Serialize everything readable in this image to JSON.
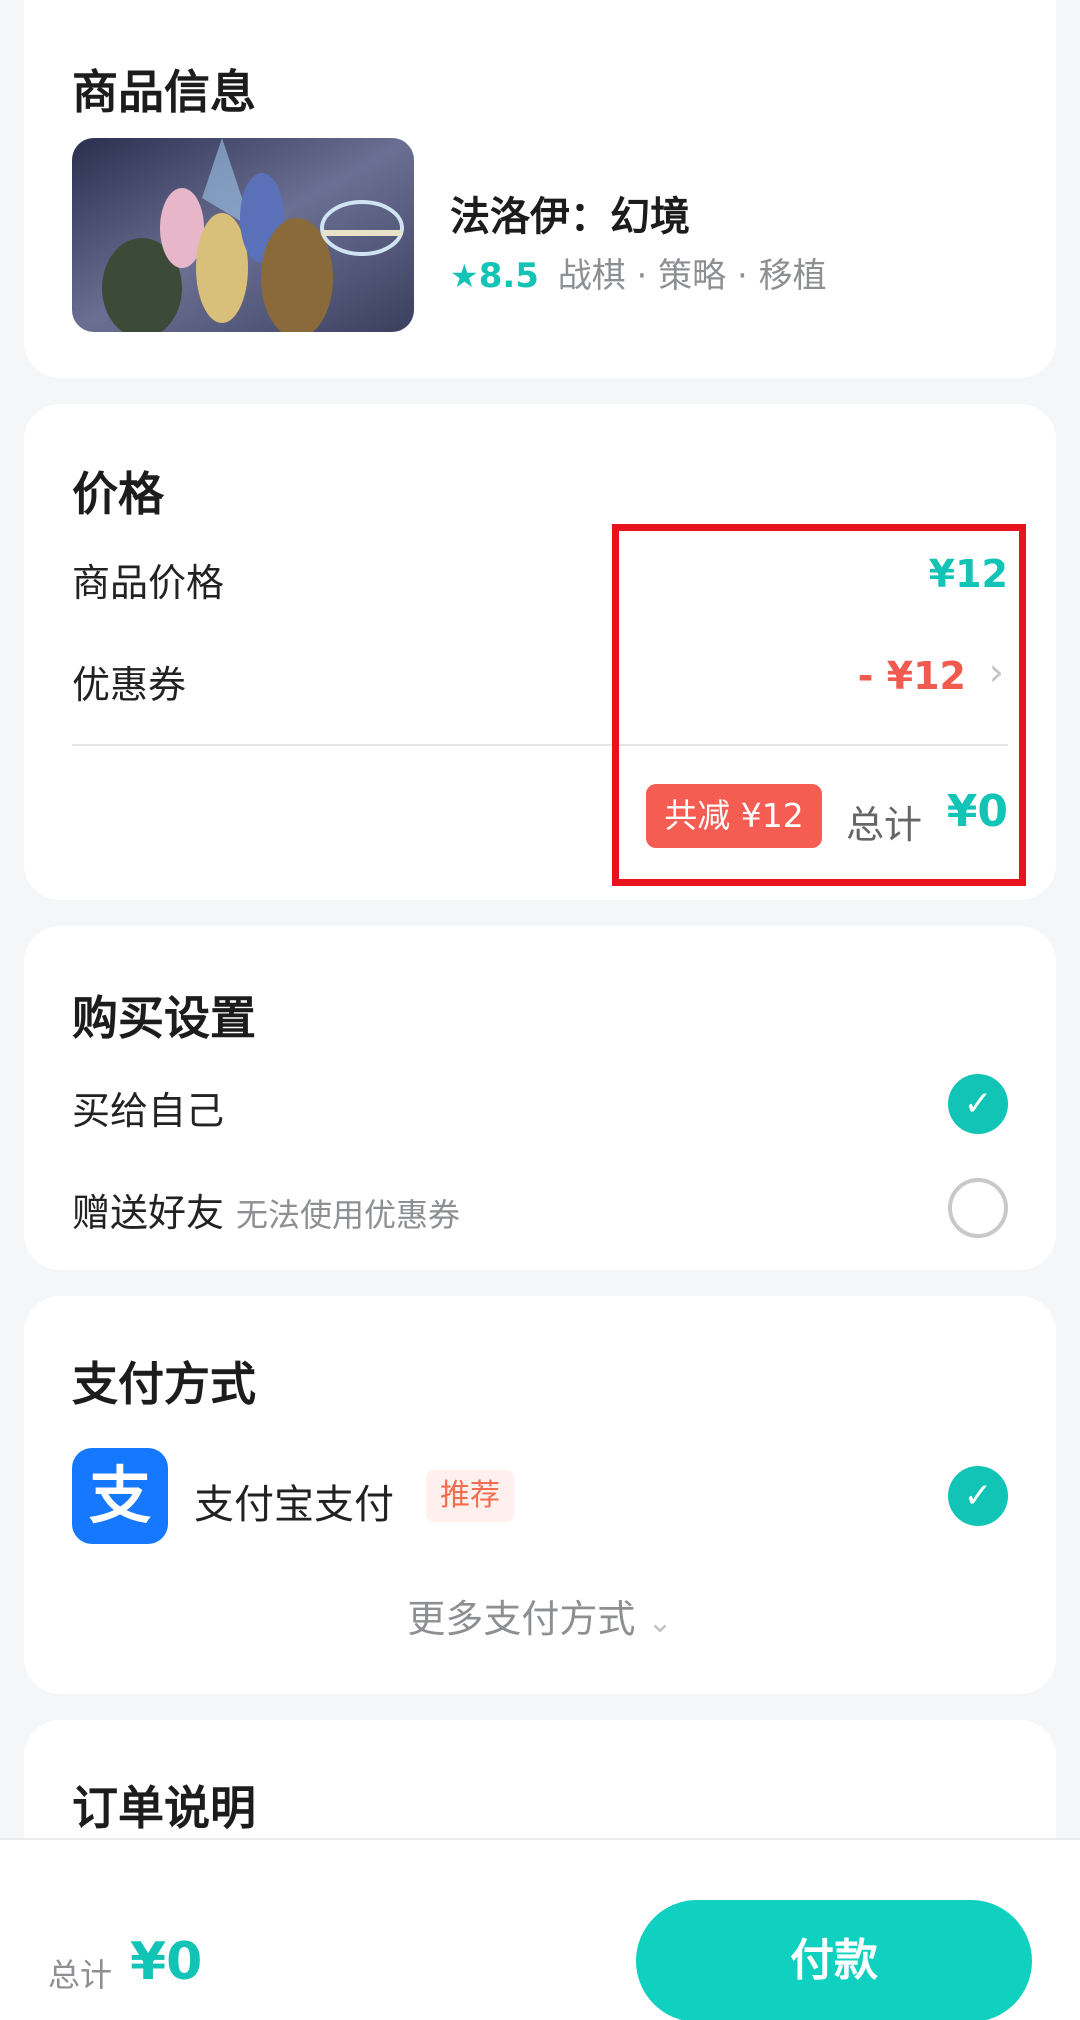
{
  "product": {
    "section_title": "商品信息",
    "name": "法洛伊：幻境",
    "rating": "8.5",
    "tags": "战棋 · 策略 · 移植"
  },
  "price": {
    "section_title": "价格",
    "item_price_label": "商品价格",
    "item_price_value": "¥12",
    "coupon_label": "优惠券",
    "coupon_value": "- ¥12",
    "discount_badge": "共减 ¥12",
    "total_label": "总计",
    "total_value": "¥0"
  },
  "purchase_settings": {
    "section_title": "购买设置",
    "self_label": "买给自己",
    "gift_label": "赠送好友",
    "gift_note": "无法使用优惠券",
    "self_selected": true,
    "gift_selected": false
  },
  "payment": {
    "section_title": "支付方式",
    "method_name": "支付宝支付",
    "method_badge": "推荐",
    "more_methods": "更多支付方式"
  },
  "order": {
    "section_title": "订单说明"
  },
  "bottom_bar": {
    "total_label": "总计",
    "total_value": "¥0",
    "pay_button": "付款"
  },
  "colors": {
    "accent": "#12c4b5",
    "discount": "#f05a4f",
    "highlight": "#e8131d",
    "alipay": "#1677ff"
  }
}
